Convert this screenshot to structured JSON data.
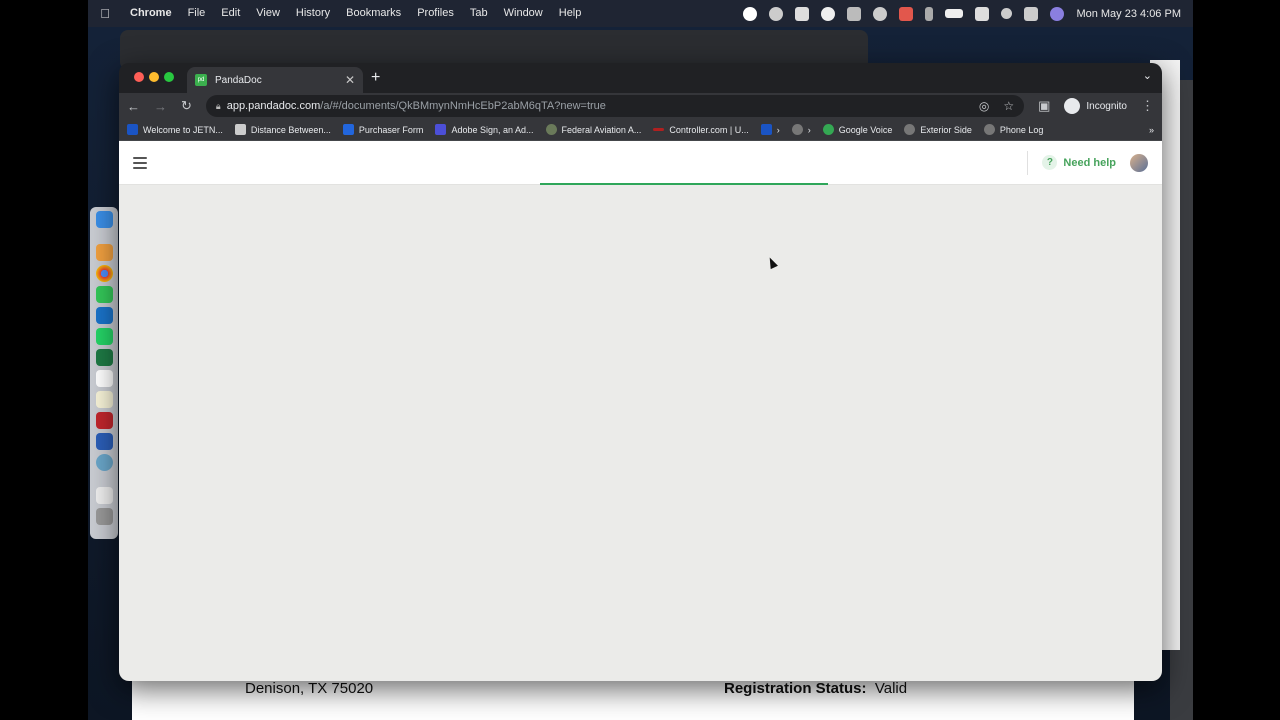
{
  "menubar": {
    "app_name": "Chrome",
    "menus": [
      "File",
      "Edit",
      "View",
      "History",
      "Bookmarks",
      "Profiles",
      "Tab",
      "Window",
      "Help"
    ],
    "clock": "Mon May 23  4:06 PM"
  },
  "browser": {
    "tab_title": "PandaDoc",
    "tab_favicon_text": "pd",
    "url_host": "app.pandadoc.com",
    "url_path": "/a/#/documents/QkBMmynNmHcEbP2abM6qTA?new=true",
    "profile_label": "Incognito",
    "bookmarks": [
      "Welcome to JETN...",
      "Distance Between...",
      "Purchaser Form",
      "Adobe Sign, an Ad...",
      "Federal Aviation A...",
      "Controller.com | U...",
      "›",
      "›",
      "Google Voice",
      "Exterior Side",
      "Phone Log"
    ],
    "bookmarks_overflow": "»"
  },
  "app": {
    "need_help_label": "Need help",
    "need_help_icon": "?"
  },
  "background_document": {
    "address_line": "Denison, TX 75020",
    "registration_label": "Registration Status:",
    "registration_value": "Valid"
  },
  "colors": {
    "accent_green": "#2fa65a",
    "page_background": "#ebebe9"
  }
}
